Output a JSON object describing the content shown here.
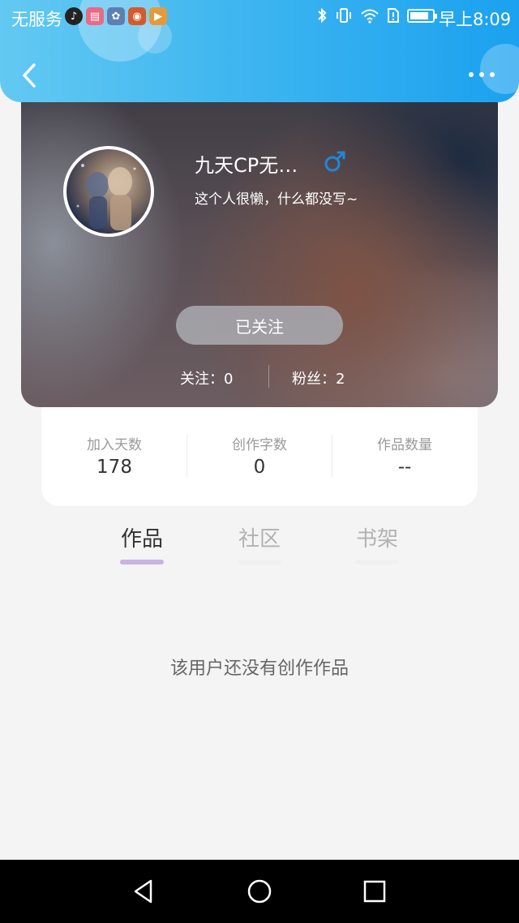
{
  "status_bar": {
    "carrier": "无服务",
    "time": "早上8:09",
    "app_icons": [
      "tiktok-icon",
      "notes-icon",
      "baidu-icon",
      "browser-icon",
      "video-icon"
    ]
  },
  "header": {
    "back_icon": "chevron-left-icon",
    "more_icon": "more-dots-icon",
    "accent_colors": [
      "#63c9f2",
      "#1ba1ef"
    ]
  },
  "profile": {
    "username": "九天CP无…",
    "gender_icon": "male-icon",
    "gender_color": "#1e88d8",
    "bio": "这个人很懒，什么都没写~",
    "follow_button": "已关注",
    "following_label": "关注：0",
    "fans_label": "粉丝：2"
  },
  "stats": [
    {
      "label": "加入天数",
      "value": "178"
    },
    {
      "label": "创作字数",
      "value": "0"
    },
    {
      "label": "作品数量",
      "value": "--"
    }
  ],
  "tabs": [
    {
      "label": "作品",
      "active": true
    },
    {
      "label": "社区",
      "active": false
    },
    {
      "label": "书架",
      "active": false
    }
  ],
  "empty_message": "该用户还没有创作作品",
  "nav": [
    "back-triangle-icon",
    "home-circle-icon",
    "recents-square-icon"
  ]
}
